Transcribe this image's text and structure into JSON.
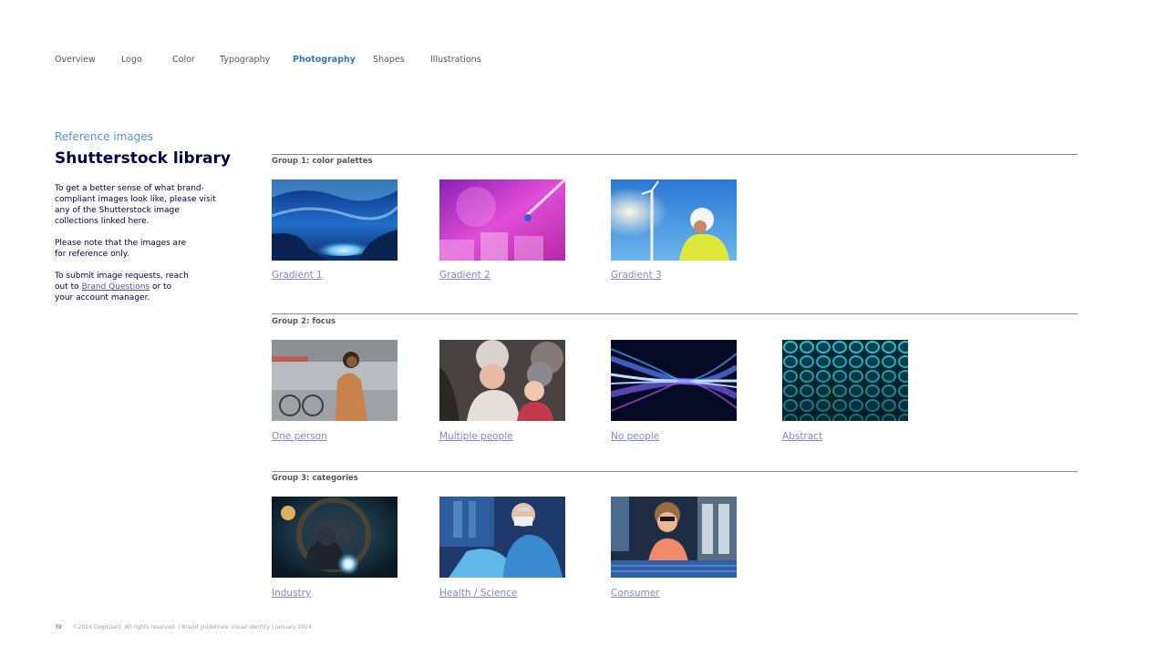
{
  "nav": {
    "items": [
      {
        "label": "Overview"
      },
      {
        "label": "Logo"
      },
      {
        "label": "Color"
      },
      {
        "label": "Typography"
      },
      {
        "label": "Photography",
        "active": true
      },
      {
        "label": "Shapes"
      },
      {
        "label": "Illustrations"
      }
    ]
  },
  "sidebar": {
    "eyebrow": "Reference images",
    "title": "Shutterstock library",
    "para1": "To get a better sense of what brand-compliant images look like, please visit any of the Shutterstock image collections linked here.",
    "para2": "Please note that the images are for reference only.",
    "para3_before": "To submit image requests, reach out to ",
    "para3_link": "Brand Questions",
    "para3_after": " or to your account manager."
  },
  "groups": [
    {
      "label": "Group 1: color palettes",
      "items": [
        {
          "link": "Gradient 1",
          "image": "ice-cave-photo"
        },
        {
          "link": "Gradient 2",
          "image": "lab-pipette-photo"
        },
        {
          "link": "Gradient 3",
          "image": "wind-turbine-worker-photo"
        }
      ]
    },
    {
      "label": "Group 2: focus",
      "items": [
        {
          "link": "One person",
          "image": "woman-with-bike-photo"
        },
        {
          "link": "Multiple people",
          "image": "mother-child-winter-photo"
        },
        {
          "link": "No people",
          "image": "light-streams-photo"
        },
        {
          "link": "Abstract",
          "image": "coral-texture-photo"
        }
      ]
    },
    {
      "label": "Group 3: categories",
      "items": [
        {
          "link": "Industry",
          "image": "welder-in-pipe-photo"
        },
        {
          "link": "Health / Science",
          "image": "doctor-xray-photo"
        },
        {
          "link": "Consumer",
          "image": "girl-ice-cream-photo"
        }
      ]
    }
  ],
  "footer": {
    "page_number": "39",
    "text": "©2024 Cognizant. All rights reserved.  |  Brand guidelines: visual identity  |  January 2024"
  },
  "colors": {
    "navy": "#000048",
    "active_nav": "#2f78c4",
    "link": "#8286d8",
    "eyebrow": "#5a8fe0"
  }
}
